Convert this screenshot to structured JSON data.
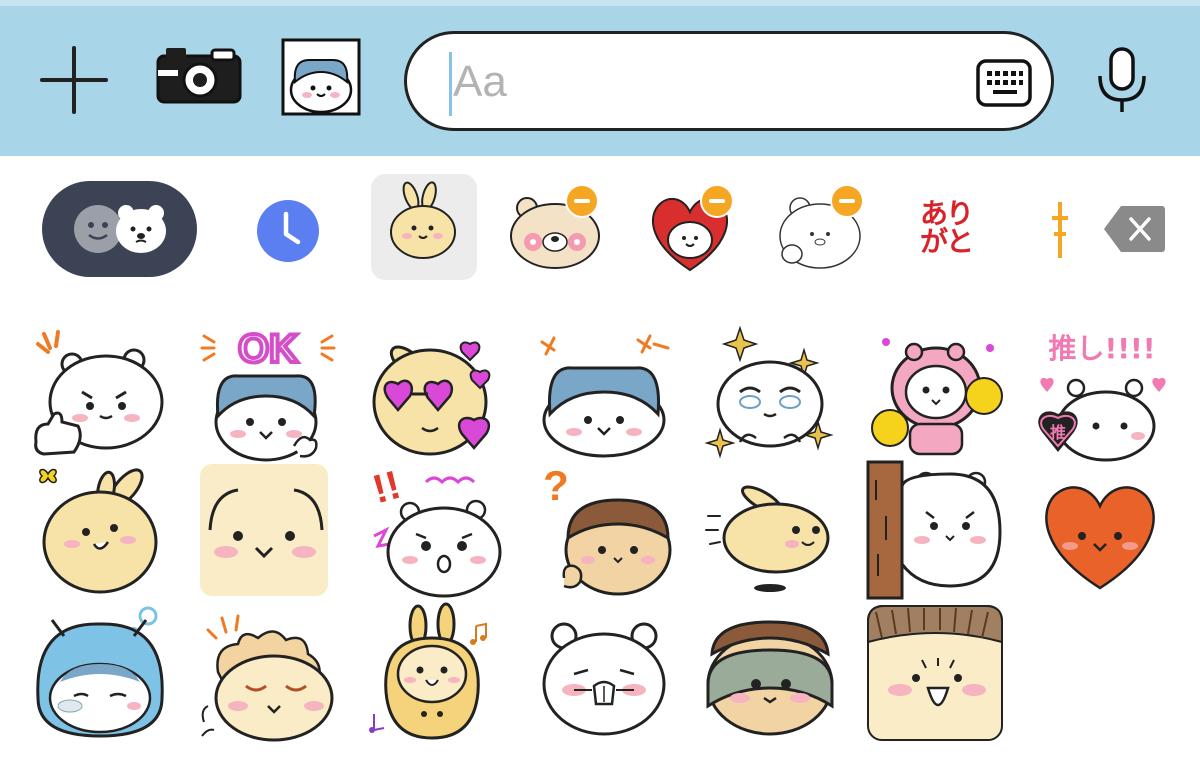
{
  "input_bar": {
    "placeholder": "Aa",
    "value": "",
    "icons": [
      "plus-icon",
      "camera-icon",
      "photo-icon",
      "keyboard-icon",
      "microphone-icon"
    ]
  },
  "tabs": {
    "items": [
      {
        "name": "emoji-tab"
      },
      {
        "name": "recent-tab",
        "icon": "clock-icon"
      },
      {
        "name": "sticker-pack-tab",
        "selected": true
      },
      {
        "name": "sticker-pack-tab",
        "badge": "minus"
      },
      {
        "name": "sticker-pack-tab",
        "badge": "minus"
      },
      {
        "name": "sticker-pack-tab",
        "badge": "minus"
      },
      {
        "name": "sticker-pack-tab",
        "label": "ありがと"
      },
      {
        "name": "sticker-pack-tab",
        "partial": true
      }
    ],
    "arigato_line1": "あり",
    "arigato_line2": "がと",
    "delete_icon": "backspace-icon"
  },
  "stickers": {
    "row1": [
      {
        "caption": ""
      },
      {
        "caption": "OK"
      },
      {
        "caption": ""
      },
      {
        "caption": ""
      },
      {
        "caption": ""
      },
      {
        "caption": ""
      },
      {
        "caption": "推し!!!!",
        "badge": "推"
      }
    ],
    "row2": [
      {
        "caption": ""
      },
      {
        "caption": ""
      },
      {
        "caption": "!!"
      },
      {
        "caption": "?"
      },
      {
        "caption": ""
      },
      {
        "caption": ""
      },
      {
        "caption": ""
      }
    ],
    "row3": [
      {
        "caption": ""
      },
      {
        "caption": ""
      },
      {
        "caption": ""
      },
      {
        "caption": ""
      },
      {
        "caption": ""
      },
      {
        "caption": ""
      }
    ]
  },
  "colors": {
    "bar": "#a9d5e8",
    "emoji_tab": "#3b4355",
    "clock": "#5b7ef1",
    "badge": "#f5a623",
    "arigato": "#d9232a",
    "cheek": "#f6b3c0",
    "usagi": "#f7e3a8",
    "hachiware": "#7aa6c7"
  }
}
